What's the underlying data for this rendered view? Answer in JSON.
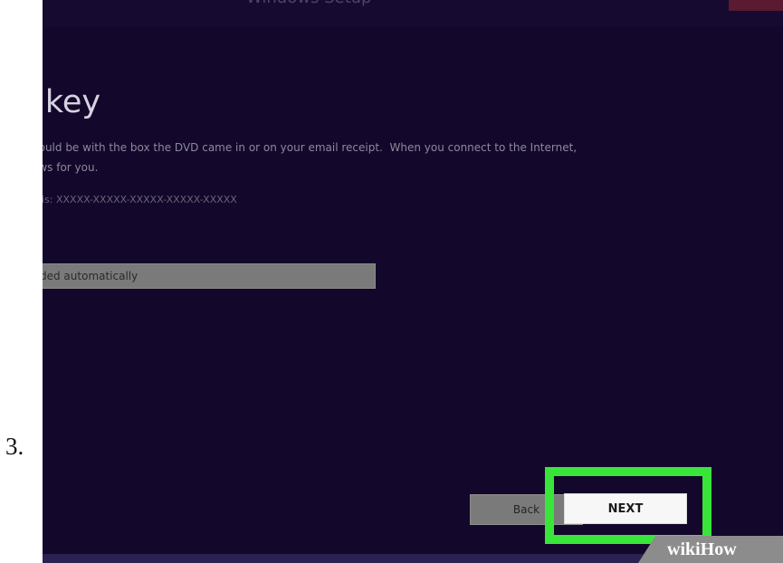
{
  "step": {
    "number": "3."
  },
  "window": {
    "title": "Windows Setup",
    "heading": "t key",
    "description": "hould be with the box the DVD came in or on your email receipt.  When you connect to the Internet,\nows for you.",
    "format_hint": "his: XXXXX-XXXXX-XXXXX-XXXXX-XXXXX",
    "key_field": {
      "value": "ded automatically"
    },
    "buttons": {
      "back": "Back",
      "next": "NEXT"
    }
  },
  "watermark": {
    "text": "wikiHow"
  },
  "colors": {
    "window_background": "#13072c",
    "highlight": "#3ae53a",
    "next_button": "#f7f7f7",
    "back_button": "#7a7a7a"
  }
}
